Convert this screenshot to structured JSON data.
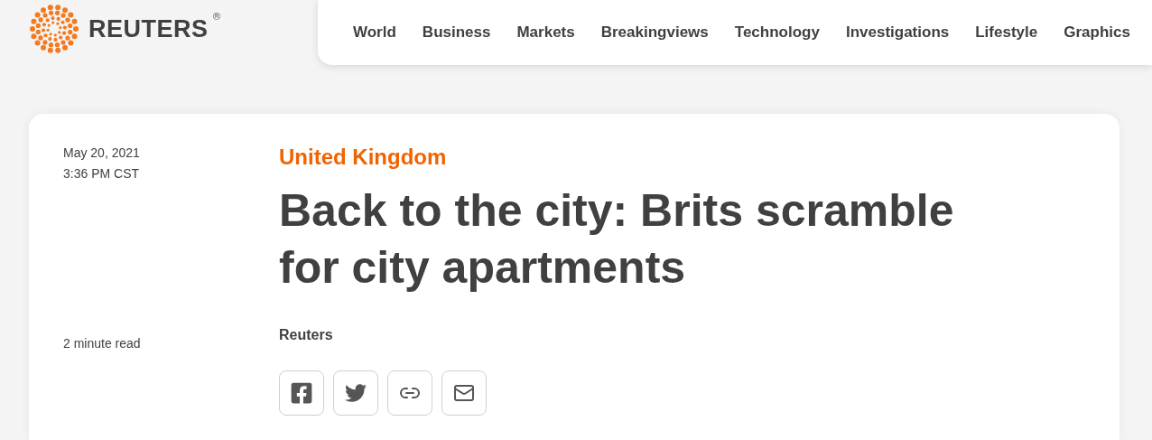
{
  "logo": {
    "wordmark": "REUTERS",
    "mark": "®"
  },
  "nav": [
    {
      "label": "World"
    },
    {
      "label": "Business"
    },
    {
      "label": "Markets"
    },
    {
      "label": "Breakingviews"
    },
    {
      "label": "Technology"
    },
    {
      "label": "Investigations"
    },
    {
      "label": "Lifestyle"
    },
    {
      "label": "Graphics"
    }
  ],
  "article": {
    "date": "May 20, 2021",
    "time": "3:36 PM CST",
    "section": "United Kingdom",
    "headline": "Back to the city: Brits scramble for city apartments",
    "read_time": "2 minute read",
    "byline": "Reuters",
    "share": [
      {
        "kind": "facebook"
      },
      {
        "kind": "twitter"
      },
      {
        "kind": "link"
      },
      {
        "kind": "email"
      }
    ]
  }
}
